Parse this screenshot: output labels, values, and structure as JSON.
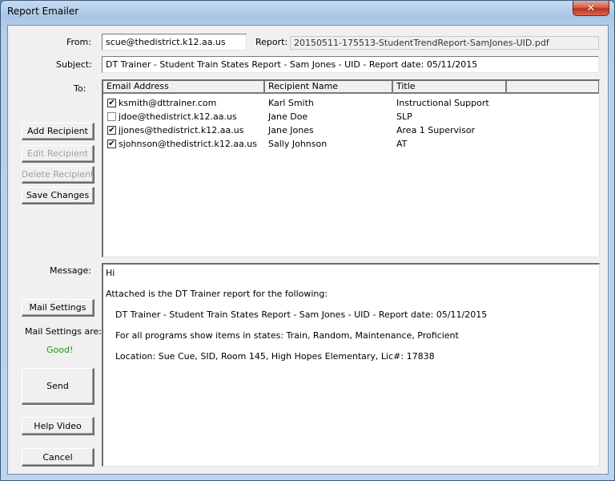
{
  "window": {
    "title": "Report Emailer",
    "close_glyph": "✕"
  },
  "form": {
    "from_label": "From:",
    "from_value": "scue@thedistrict.k12.aa.us",
    "report_label": "Report:",
    "report_value": "20150511-175513-StudentTrendReport-SamJones-UID.pdf",
    "subject_label": "Subject:",
    "subject_value": "DT Trainer - Student Train States Report - Sam Jones - UID - Report date: 05/11/2015",
    "to_label": "To:",
    "message_label": "Message:"
  },
  "recipients": {
    "columns": [
      "Email Address",
      "Recipient Name",
      "Title",
      ""
    ],
    "rows": [
      {
        "checked": true,
        "email": "ksmith@dttrainer.com",
        "name": "Karl Smith",
        "title": "Instructional Support"
      },
      {
        "checked": false,
        "email": "jdoe@thedistrict.k12.aa.us",
        "name": "Jane Doe",
        "title": "SLP"
      },
      {
        "checked": true,
        "email": "jjones@thedistrict.k12.aa.us",
        "name": "Jane Jones",
        "title": "Area 1 Supervisor"
      },
      {
        "checked": true,
        "email": "sjohnson@thedistrict.k12.aa.us",
        "name": "Sally Johnson",
        "title": "AT"
      }
    ]
  },
  "buttons": {
    "add_recipient": "Add Recipient",
    "edit_recipient": "Edit Recipient",
    "delete_recipient": "Delete Recipient",
    "save_changes": "Save Changes",
    "mail_settings": "Mail Settings",
    "send": "Send",
    "help_video": "Help Video",
    "cancel": "Cancel"
  },
  "mail_status": {
    "label": "Mail Settings are:",
    "value": "Good!",
    "value_color": "#1a9a1a"
  },
  "message": {
    "lines": [
      "Hi",
      "Attached is the DT Trainer report for the following:",
      "DT Trainer - Student Train States Report - Sam Jones - UID - Report date: 05/11/2015",
      "For all programs show items in states: Train, Random, Maintenance, Proficient",
      "Location: Sue Cue, SID, Room 145, High Hopes Elementary, Lic#: 17838"
    ]
  }
}
